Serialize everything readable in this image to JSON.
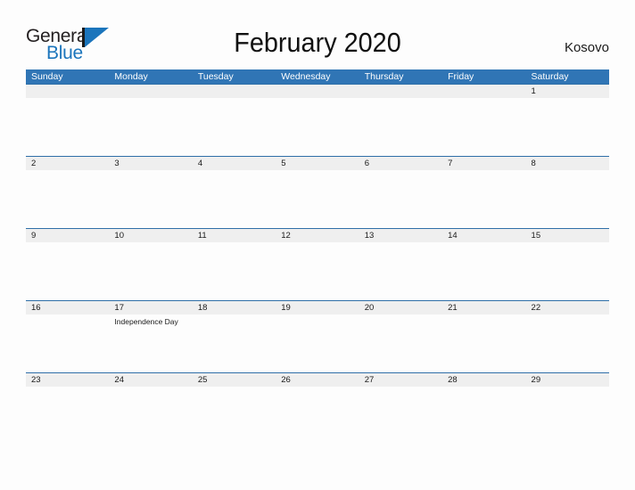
{
  "brand": {
    "name_part1": "General",
    "name_part2": "Blue",
    "flag_color": "#1b75bc"
  },
  "header": {
    "title": "February 2020",
    "country": "Kosovo"
  },
  "calendar": {
    "header_color": "#3075b5",
    "date_band_color": "#efefef",
    "weekdays": [
      "Sunday",
      "Monday",
      "Tuesday",
      "Wednesday",
      "Thursday",
      "Friday",
      "Saturday"
    ],
    "weeks": [
      {
        "dates": [
          "",
          "",
          "",
          "",
          "",
          "",
          "1"
        ],
        "events": [
          "",
          "",
          "",
          "",
          "",
          "",
          ""
        ]
      },
      {
        "dates": [
          "2",
          "3",
          "4",
          "5",
          "6",
          "7",
          "8"
        ],
        "events": [
          "",
          "",
          "",
          "",
          "",
          "",
          ""
        ]
      },
      {
        "dates": [
          "9",
          "10",
          "11",
          "12",
          "13",
          "14",
          "15"
        ],
        "events": [
          "",
          "",
          "",
          "",
          "",
          "",
          ""
        ]
      },
      {
        "dates": [
          "16",
          "17",
          "18",
          "19",
          "20",
          "21",
          "22"
        ],
        "events": [
          "",
          "Independence Day",
          "",
          "",
          "",
          "",
          ""
        ]
      },
      {
        "dates": [
          "23",
          "24",
          "25",
          "26",
          "27",
          "28",
          "29"
        ],
        "events": [
          "",
          "",
          "",
          "",
          "",
          "",
          ""
        ]
      }
    ]
  }
}
